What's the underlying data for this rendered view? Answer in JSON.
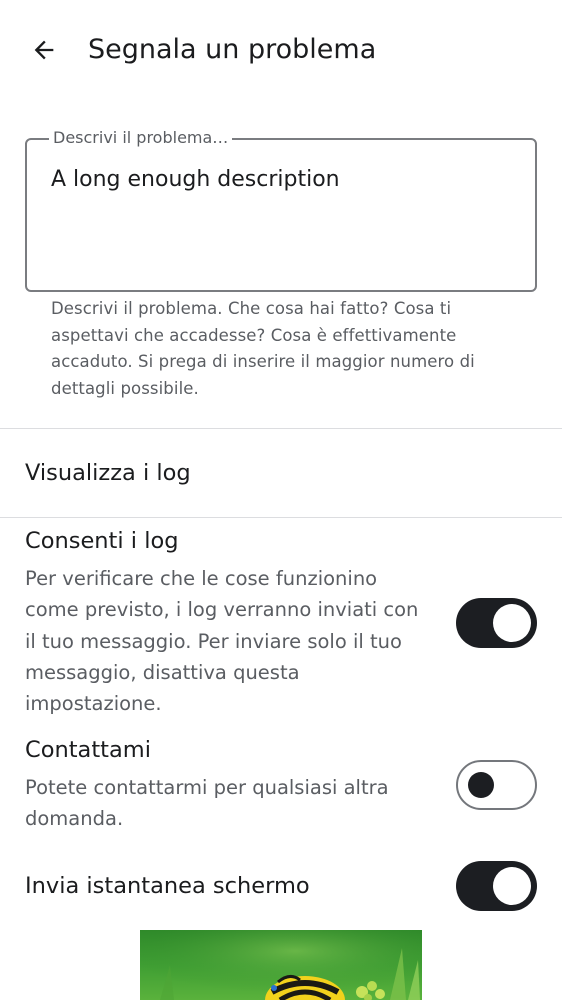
{
  "header": {
    "back_icon": "arrow-left-icon",
    "title": "Segnala un problema"
  },
  "description_field": {
    "label": "Descrivi il problema…",
    "value": "A long enough description",
    "helper": "Descrivi il problema. Che cosa hai fatto? Cosa ti aspettavi che accadesse? Cosa è effettivamente accaduto. Si prega di inserire il maggior numero di dettagli possibile."
  },
  "view_logs": {
    "label": "Visualizza i log"
  },
  "settings": {
    "allow_logs": {
      "title": "Consenti i log",
      "description": "Per verificare che le cose funzionino come previsto, i log verranno inviati con il tuo messaggio. Per inviare solo il tuo messaggio, disattiva questa impostazione.",
      "enabled": true
    },
    "contact_me": {
      "title": "Contattami",
      "description": "Potete contattarmi per qualsiasi altra domanda.",
      "enabled": false
    },
    "send_screenshot": {
      "title": "Invia istantanea schermo",
      "enabled": true
    }
  },
  "colors": {
    "switch_on_track": "#1c1e22",
    "switch_off_border": "#74777c",
    "text_primary": "#1b1c1e",
    "text_secondary": "#5a5d62",
    "divider": "#dcdde0"
  }
}
